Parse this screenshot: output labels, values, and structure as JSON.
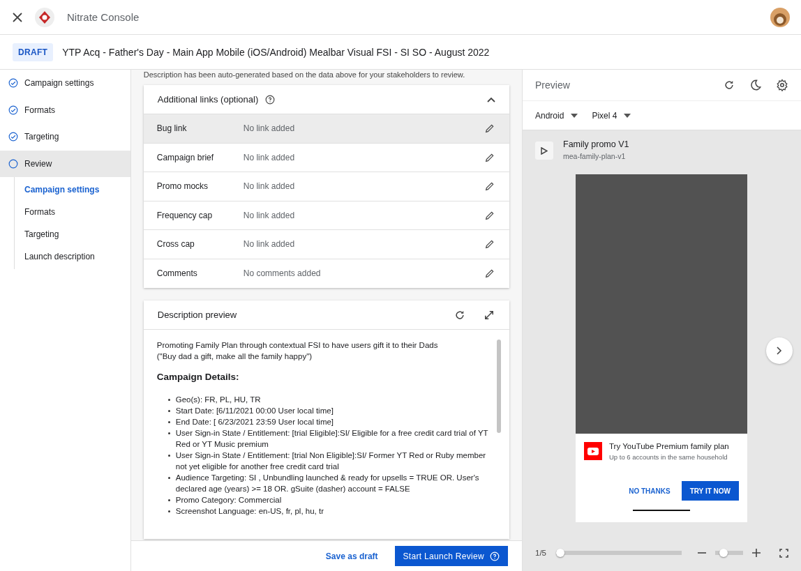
{
  "app": {
    "title": "Nitrate Console"
  },
  "campaign": {
    "status": "DRAFT",
    "title": "YTP Acq - Father's Day - Main App Mobile (iOS/Android) Mealbar Visual FSI - SI SO - August 2022"
  },
  "sidebar": {
    "steps": [
      {
        "label": "Campaign settings",
        "done": true,
        "selected": false
      },
      {
        "label": "Formats",
        "done": true,
        "selected": false
      },
      {
        "label": "Targeting",
        "done": true,
        "selected": false
      },
      {
        "label": "Review",
        "done": false,
        "selected": true
      }
    ],
    "subitems": [
      {
        "label": "Campaign settings",
        "selected": true
      },
      {
        "label": "Formats",
        "selected": false
      },
      {
        "label": "Targeting",
        "selected": false
      },
      {
        "label": "Launch description",
        "selected": false
      }
    ]
  },
  "intro": "Description has been auto-generated based on the data above for your stakeholders to review.",
  "links_card": {
    "title": "Additional links (optional)",
    "expanded": true,
    "rows": [
      {
        "label": "Bug link",
        "value": "No link added",
        "hovered": true
      },
      {
        "label": "Campaign brief",
        "value": "No link added",
        "hovered": false
      },
      {
        "label": "Promo mocks",
        "value": "No link added",
        "hovered": false
      },
      {
        "label": "Frequency cap",
        "value": "No link added",
        "hovered": false
      },
      {
        "label": "Cross cap",
        "value": "No link added",
        "hovered": false
      },
      {
        "label": "Comments",
        "value": "No comments added",
        "hovered": false
      }
    ]
  },
  "description_card": {
    "title": "Description preview",
    "intro_lines": [
      "Promoting Family Plan through contextual FSI to have users gift it to their Dads",
      "(\"Buy dad a gift, make all the family happy\")"
    ],
    "heading": "Campaign Details:",
    "bullets": [
      "Geo(s): FR, PL, HU, TR",
      "Start Date: [6/11/2021 00:00 User local time]",
      "End Date: [ 6/23/2021 23:59 User local time]",
      "User Sign-in State / Entitlement: [trial Eligible]:SI/ Eligible for a free credit card trial of YT Red or YT Music premium",
      "User Sign-in State / Entitlement: [trial Non Eligible]:SI/ Former YT Red or Ruby member not yet eligible for another free credit card trial",
      "Audience Targeting: SI , Unbundling launched & ready for upsells = TRUE OR. User's declared age (years) >= 18 OR. gSuite (dasher) account = FALSE",
      "Promo Category: Commercial",
      "Screenshot Language: en-US, fr, pl, hu, tr"
    ]
  },
  "footer": {
    "secondary": "Save as draft",
    "primary": "Start Launch Review"
  },
  "preview": {
    "title": "Preview",
    "platform": "Android",
    "device": "Pixel 4",
    "promo_name": "Family promo V1",
    "promo_id": "mea-family-plan-v1",
    "mealbar": {
      "title": "Try YouTube Premium family plan",
      "subtitle": "Up to 6 accounts in the same household",
      "dismiss": "NO THANKS",
      "accept": "TRY IT NOW"
    },
    "page": "1/5",
    "progress": {
      "level": 0
    },
    "zoom": {
      "level": 0.2
    }
  }
}
